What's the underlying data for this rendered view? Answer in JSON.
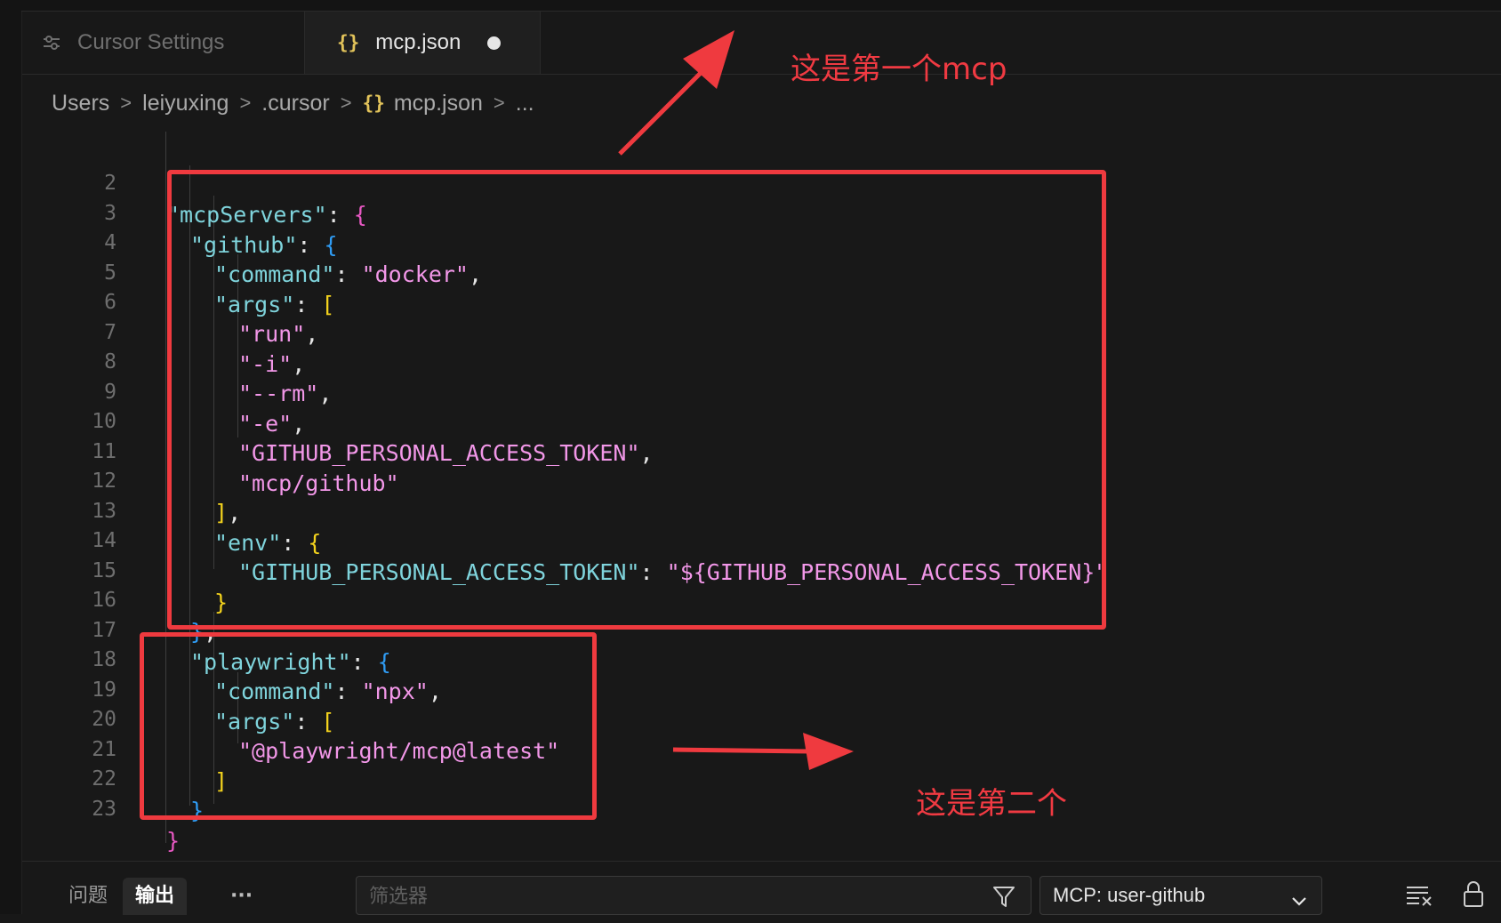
{
  "tabs": [
    {
      "label": "Cursor Settings",
      "icon": "settings-sliders-icon",
      "active": false
    },
    {
      "label": "mcp.json",
      "icon": "json-braces-icon",
      "active": true,
      "dirty": true
    }
  ],
  "json_icon_text": "{}",
  "breadcrumb": {
    "items": [
      "Users",
      "leiyuxing",
      ".cursor",
      "mcp.json",
      "..."
    ],
    "separator": ">"
  },
  "editor": {
    "line_numbers": [
      "2",
      "3",
      "4",
      "5",
      "6",
      "7",
      "8",
      "9",
      "10",
      "11",
      "12",
      "13",
      "14",
      "15",
      "16",
      "17",
      "18",
      "19",
      "20",
      "21",
      "22",
      "23"
    ],
    "tokens": {
      "mcpServers": "\"mcpServers\"",
      "github": "\"github\"",
      "command": "\"command\"",
      "docker": "\"docker\"",
      "args": "\"args\"",
      "run": "\"run\"",
      "i": "\"-i\"",
      "rm": "\"--rm\"",
      "e": "\"-e\"",
      "token": "\"GITHUB_PERSONAL_ACCESS_TOKEN\"",
      "mcp_github": "\"mcp/github\"",
      "env": "\"env\"",
      "token_value": "\"${GITHUB_PERSONAL_ACCESS_TOKEN}\"",
      "playwright": "\"playwright\"",
      "npx": "\"npx\"",
      "playwright_pkg": "\"@playwright/mcp@latest\""
    },
    "punct": {
      "colon": ": ",
      "comma": ",",
      "lbrace": "{",
      "rbrace": "}",
      "lbracket": "[",
      "rbracket": "]",
      "rbrace_comma": "},",
      "rbracket_comma": "],"
    }
  },
  "annotations": {
    "first": "这是第一个mcp",
    "second": "这是第二个"
  },
  "panel": {
    "tabs": [
      "问题",
      "输出",
      "···"
    ],
    "filter_placeholder": "筛选器",
    "channel": "MCP: user-github",
    "icons": [
      "filter-icon",
      "chevron-down-icon",
      "clear-output-icon",
      "lock-icon"
    ]
  },
  "colors": {
    "annotation": "#ef3a3f",
    "key": "#7fd4dc",
    "string": "#f297e8",
    "bracket_level1": "#e858c3",
    "bracket_level2": "#2f9cf4",
    "bracket_level3": "#f3d21d"
  }
}
